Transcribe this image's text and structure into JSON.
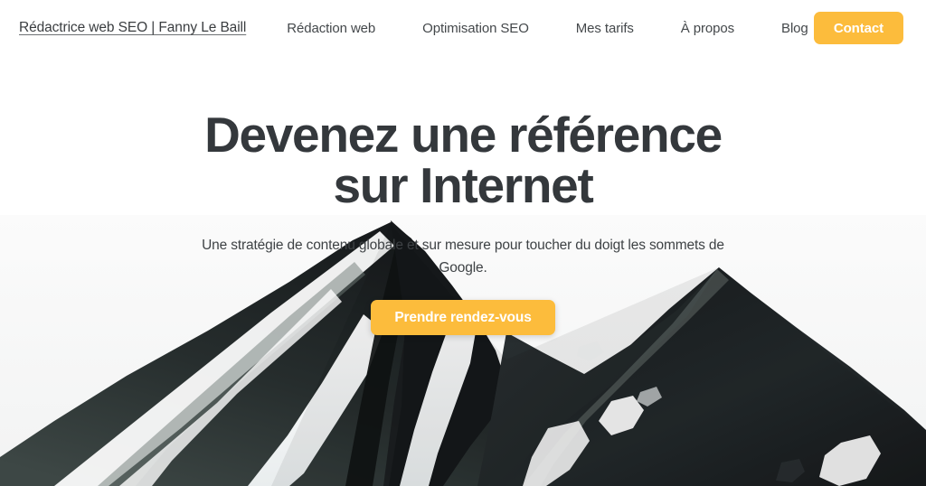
{
  "navbar": {
    "brand": "Rédactrice web SEO | Fanny Le Baill",
    "links": [
      {
        "label": "Rédaction web"
      },
      {
        "label": "Optimisation SEO"
      },
      {
        "label": "Mes tarifs"
      },
      {
        "label": "À propos"
      },
      {
        "label": "Blog"
      }
    ],
    "cta_label": "Contact"
  },
  "hero": {
    "title": "Devenez une référence sur Internet",
    "subtitle": "Une stratégie de contenu globale et sur mesure pour toucher du doigt les sommets de Google.",
    "cta_label": "Prendre rendez-vous",
    "background_image_alt": "mountain-peak-photo"
  },
  "colors": {
    "accent": "#fcbc3c",
    "heading": "#34383c",
    "body_text": "#3e4245",
    "nav_text": "#44484b",
    "page_background": "#ffffff",
    "sky": "#f7f7f7",
    "rock_dark": "#17191a",
    "rock_mid": "#2e3436",
    "rock_light": "#59625f",
    "snow": "#ffffff"
  }
}
